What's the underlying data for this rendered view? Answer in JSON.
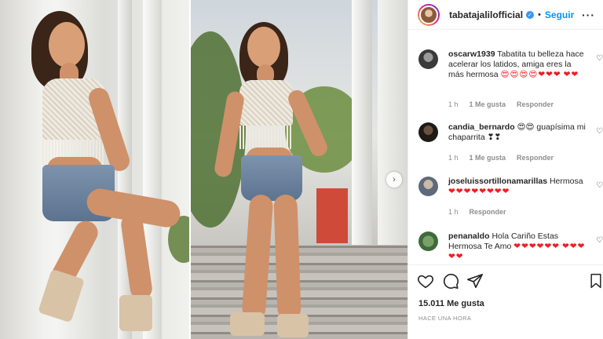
{
  "post_header": {
    "username": "tabatajalilofficial",
    "separator": "•",
    "follow_label": "Seguir",
    "more_label": "···"
  },
  "comments": [
    {
      "username": "oscarw1939",
      "text": "Tabatita tu belleza hace acelerar los latidos, amiga eres la más hermosa",
      "emojis": "😍😍😍😍❤❤❤",
      "emojis2": "❤❤",
      "time": "1 h",
      "likes": "1 Me gusta",
      "reply": "Responder"
    },
    {
      "username": "candia_bernardo",
      "text": "😍😍 guapísima mi chaparrita ❣❣",
      "time": "1 h",
      "likes": "1 Me gusta",
      "reply": "Responder"
    },
    {
      "username": "joseluissortillonamarillas",
      "text": "Hermosa",
      "emojis": "❤❤❤❤❤❤❤❤",
      "time": "1 h",
      "reply": "Responder"
    },
    {
      "username": "penanaldo",
      "text": "Hola Cariño Estas Hermosa Te Amo",
      "emojis": "❤❤❤❤❤❤",
      "emojis2": "❤❤❤❤❤"
    }
  ],
  "footer": {
    "likes_count": "15.011 Me gusta",
    "time_ago": "HACE UNA HORA"
  },
  "carousel": {
    "next_glyph": "›"
  },
  "colors": {
    "accent": "#0095f6",
    "verified": "#3897f0",
    "muted": "#8e8e8e",
    "heart": "#ed1d24"
  }
}
